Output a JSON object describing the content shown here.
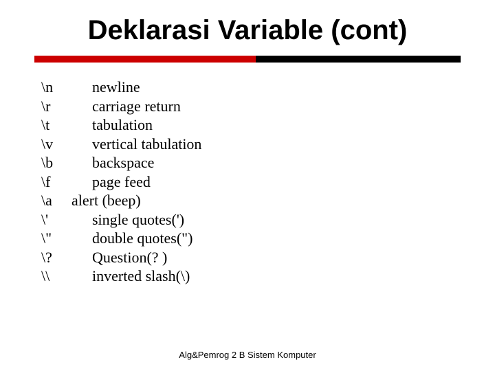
{
  "title": "Deklarasi Variable (cont)",
  "rows": [
    {
      "esc": "\\n",
      "desc": "newline"
    },
    {
      "esc": "\\r",
      "desc": "carriage return"
    },
    {
      "esc": "\\t",
      "desc": "tabulation"
    },
    {
      "esc": "\\v",
      "desc": "vertical tabulation"
    },
    {
      "esc": "\\b",
      "desc": "backspace"
    },
    {
      "esc": "\\f",
      "desc": "page feed"
    },
    {
      "esc": "\\a",
      "desc": "alert (beep)"
    },
    {
      "esc": "\\'",
      "desc": "single quotes(')"
    },
    {
      "esc": "\\\"",
      "desc": "double quotes(\")"
    },
    {
      "esc": "\\?",
      "desc": "Question(? )"
    },
    {
      "esc": "\\\\",
      "desc": "inverted slash(\\)"
    }
  ],
  "footer": "Alg&Pemrog 2 B Sistem Komputer"
}
